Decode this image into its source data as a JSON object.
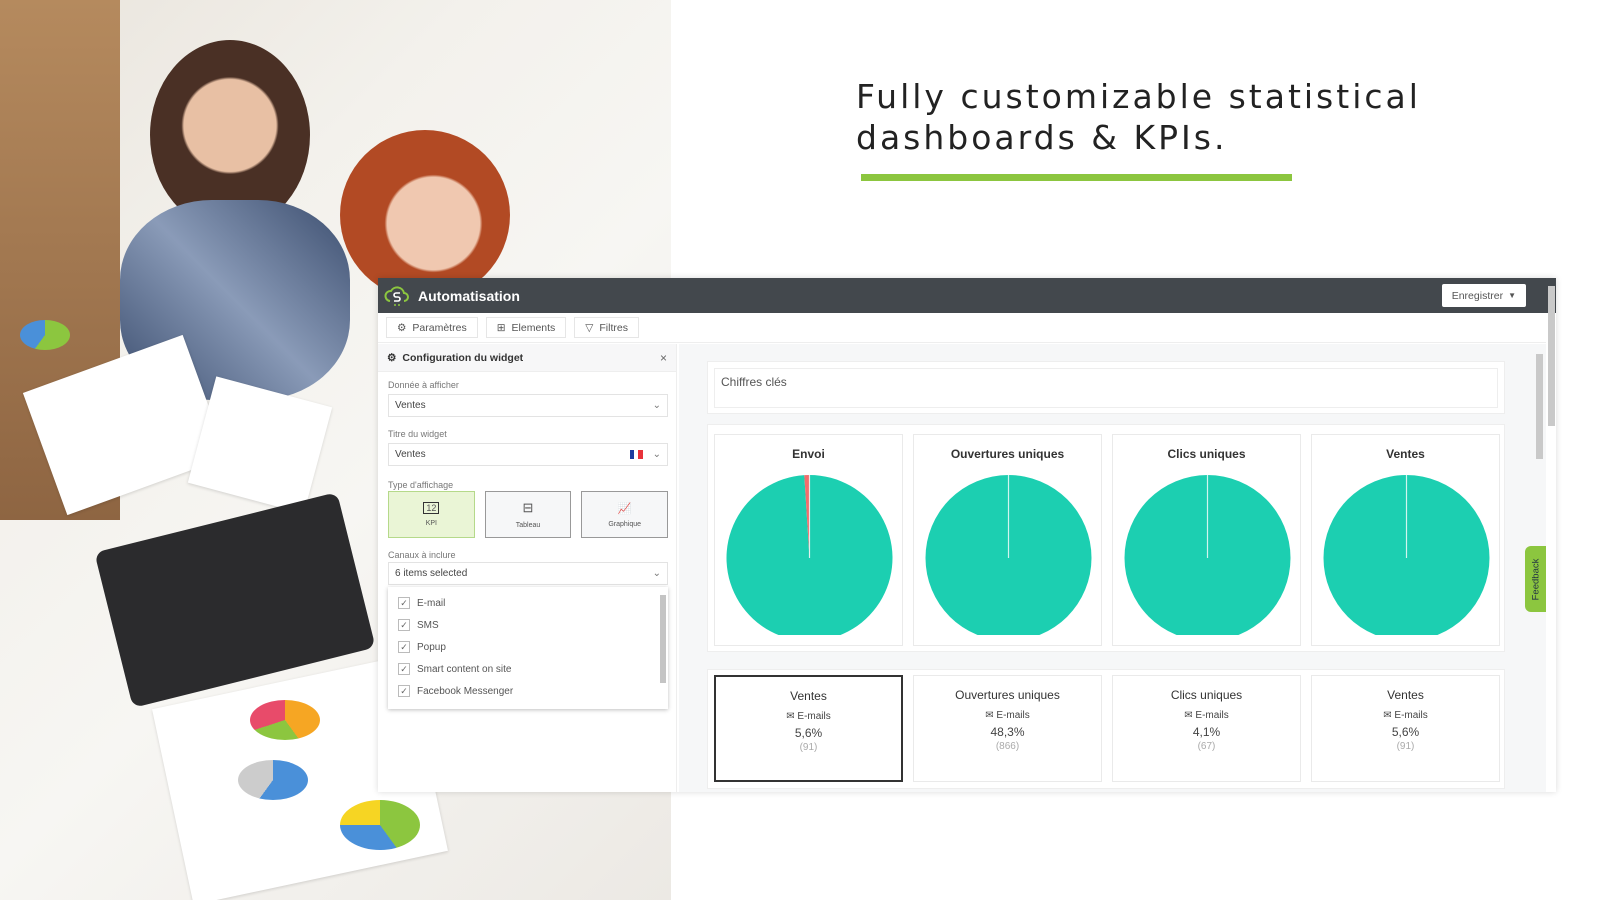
{
  "headline": {
    "line1": "Fully customizable statistical",
    "line2": "dashboards & KPIs."
  },
  "colors": {
    "accent": "#8cc63f",
    "header": "#43484d",
    "pie_main": "#1ccfb1",
    "pie_minor": "#f26d6d"
  },
  "app": {
    "title": "Automatisation",
    "save_button": "Enregistrer",
    "tabs": [
      {
        "label": "Paramètres",
        "icon": "gear-icon"
      },
      {
        "label": "Elements",
        "icon": "grid-icon"
      },
      {
        "label": "Filtres",
        "icon": "filter-icon"
      }
    ]
  },
  "config": {
    "title": "Configuration du widget",
    "data_label": "Donnée à afficher",
    "data_value": "Ventes",
    "widget_title_label": "Titre du widget",
    "widget_title_value": "Ventes",
    "display_type_label": "Type d'affichage",
    "display_types": [
      {
        "label": "KPI",
        "icon": "kpi-icon",
        "active": true
      },
      {
        "label": "Tableau",
        "icon": "table-icon",
        "active": false
      },
      {
        "label": "Graphique",
        "icon": "chart-icon",
        "active": false
      }
    ],
    "channels_label": "Canaux à inclure",
    "channels_value": "6 items selected",
    "channels": [
      {
        "label": "E-mail",
        "checked": true
      },
      {
        "label": "SMS",
        "checked": true
      },
      {
        "label": "Popup",
        "checked": true
      },
      {
        "label": "Smart content on site",
        "checked": true
      },
      {
        "label": "Facebook Messenger",
        "checked": true
      }
    ]
  },
  "dashboard": {
    "section_title": "Chiffres clés",
    "pies": [
      {
        "title": "Envoi",
        "slices": [
          0.99,
          0.01
        ]
      },
      {
        "title": "Ouvertures uniques",
        "slices": [
          1.0
        ]
      },
      {
        "title": "Clics uniques",
        "slices": [
          1.0
        ]
      },
      {
        "title": "Ventes",
        "slices": [
          1.0
        ]
      }
    ],
    "kpis": [
      {
        "title": "Ventes",
        "channel": "E-mails",
        "value": "5,6%",
        "count": "(91)",
        "selected": true
      },
      {
        "title": "Ouvertures uniques",
        "channel": "E-mails",
        "value": "48,3%",
        "count": "(866)",
        "selected": false
      },
      {
        "title": "Clics uniques",
        "channel": "E-mails",
        "value": "4,1%",
        "count": "(67)",
        "selected": false
      },
      {
        "title": "Ventes",
        "channel": "E-mails",
        "value": "5,6%",
        "count": "(91)",
        "selected": false
      }
    ],
    "feedback": "Feedback"
  }
}
